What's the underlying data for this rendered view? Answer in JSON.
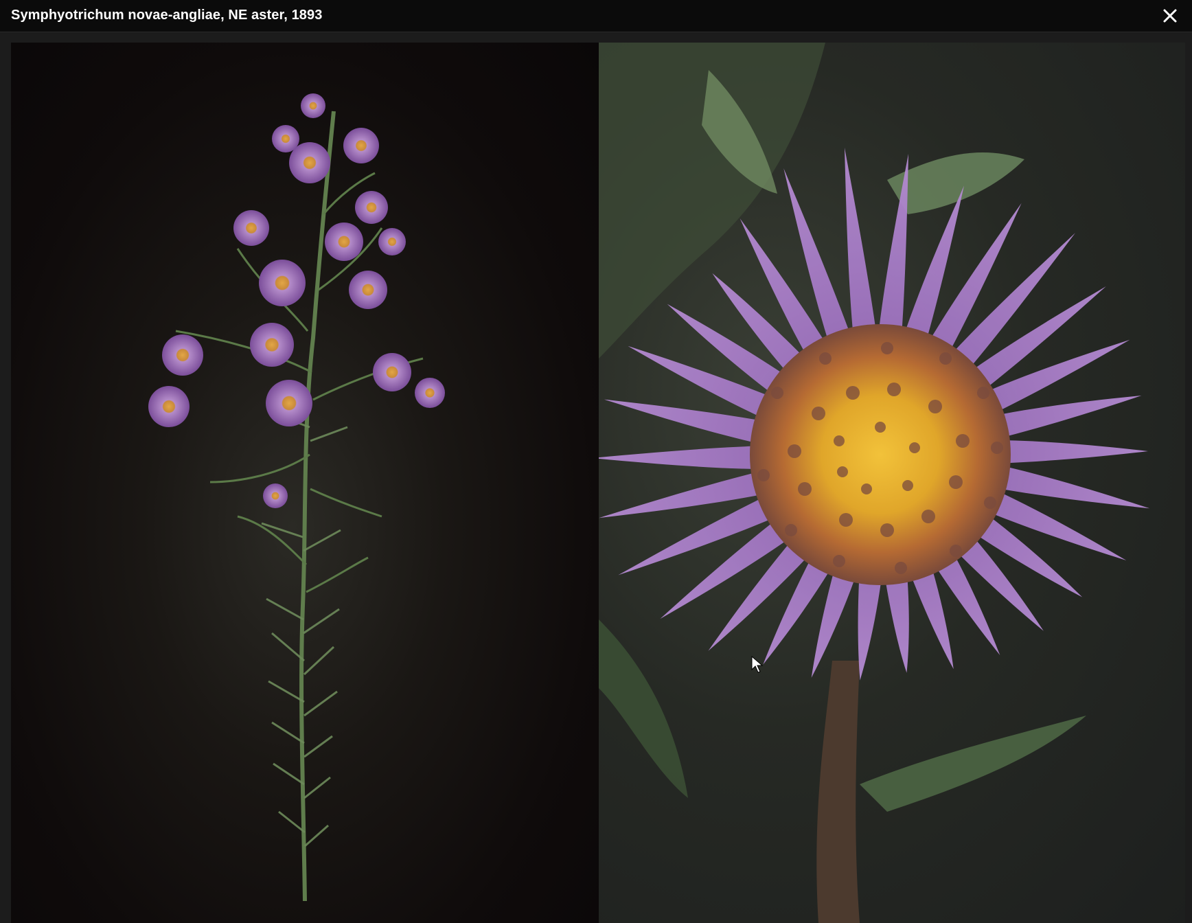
{
  "window": {
    "title": "Symphyotrichum novae-angliae, NE aster, 1893"
  },
  "controls": {
    "close_icon": "close-icon"
  },
  "images": [
    {
      "name": "whole-plant-photo",
      "subject": "flowering stem"
    },
    {
      "name": "flower-closeup-photo",
      "subject": "flower head closeup"
    }
  ],
  "colors": {
    "titlebar_bg": "#0b0b0b",
    "petal": "#9c6fbe",
    "disk": "#e0a62a",
    "stem": "#5d7a4e"
  }
}
